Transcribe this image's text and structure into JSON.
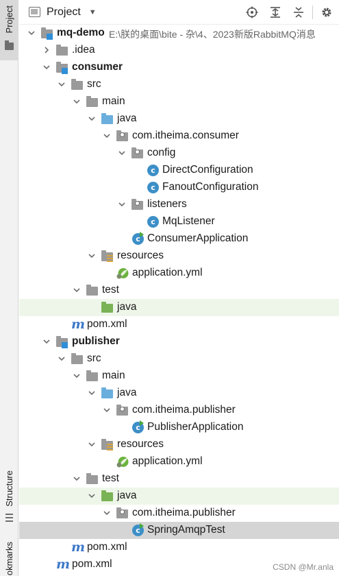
{
  "sidebar": {
    "project_tab": "Project",
    "structure_tab": "Structure",
    "bookmarks_tab": "okmarks"
  },
  "header": {
    "title": "Project",
    "tools": [
      "locate-icon",
      "expand-all-icon",
      "collapse-all-icon",
      "gear-icon"
    ]
  },
  "tree": [
    {
      "label": "mq-demo",
      "path": "E:\\朕的桌面\\bite - 杂\\4、2023新版RabbitMQ消息",
      "icon": "module-folder",
      "bold": true,
      "depth": 0,
      "expanded": true
    },
    {
      "label": ".idea",
      "icon": "folder-grey",
      "depth": 1,
      "expanded": false
    },
    {
      "label": "consumer",
      "icon": "module-folder",
      "bold": true,
      "depth": 1,
      "expanded": true
    },
    {
      "label": "src",
      "icon": "folder-grey",
      "depth": 2,
      "expanded": true
    },
    {
      "label": "main",
      "icon": "folder-grey",
      "depth": 3,
      "expanded": true
    },
    {
      "label": "java",
      "icon": "folder-blue",
      "depth": 4,
      "expanded": true
    },
    {
      "label": "com.itheima.consumer",
      "icon": "package",
      "depth": 5,
      "expanded": true
    },
    {
      "label": "config",
      "icon": "package",
      "depth": 6,
      "expanded": true
    },
    {
      "label": "DirectConfiguration",
      "icon": "class",
      "depth": 7
    },
    {
      "label": "FanoutConfiguration",
      "icon": "class",
      "depth": 7
    },
    {
      "label": "listeners",
      "icon": "package",
      "depth": 6,
      "expanded": true
    },
    {
      "label": "MqListener",
      "icon": "class",
      "depth": 7
    },
    {
      "label": "ConsumerApplication",
      "icon": "class-run",
      "depth": 6
    },
    {
      "label": "resources",
      "icon": "resources",
      "depth": 4,
      "expanded": true
    },
    {
      "label": "application.yml",
      "icon": "spring-yml",
      "depth": 5
    },
    {
      "label": "test",
      "icon": "folder-grey",
      "depth": 3,
      "expanded": true
    },
    {
      "label": "java",
      "icon": "folder-green",
      "depth": 4,
      "highlight": "green"
    },
    {
      "label": "pom.xml",
      "icon": "maven",
      "depth": 2
    },
    {
      "label": "publisher",
      "icon": "module-folder",
      "bold": true,
      "depth": 1,
      "expanded": true
    },
    {
      "label": "src",
      "icon": "folder-grey",
      "depth": 2,
      "expanded": true
    },
    {
      "label": "main",
      "icon": "folder-grey",
      "depth": 3,
      "expanded": true
    },
    {
      "label": "java",
      "icon": "folder-blue",
      "depth": 4,
      "expanded": true
    },
    {
      "label": "com.itheima.publisher",
      "icon": "package",
      "depth": 5,
      "expanded": true
    },
    {
      "label": "PublisherApplication",
      "icon": "class-run",
      "depth": 6
    },
    {
      "label": "resources",
      "icon": "resources",
      "depth": 4,
      "expanded": true
    },
    {
      "label": "application.yml",
      "icon": "spring-yml",
      "depth": 5
    },
    {
      "label": "test",
      "icon": "folder-grey",
      "depth": 3,
      "expanded": true
    },
    {
      "label": "java",
      "icon": "folder-green",
      "depth": 4,
      "expanded": true,
      "highlight": "green"
    },
    {
      "label": "com.itheima.publisher",
      "icon": "package",
      "depth": 5,
      "expanded": true
    },
    {
      "label": "SpringAmqpTest",
      "icon": "class-run",
      "depth": 6,
      "highlight": "selected"
    },
    {
      "label": "pom.xml",
      "icon": "maven",
      "depth": 2
    },
    {
      "label": "pom.xml",
      "icon": "maven",
      "depth": 1
    }
  ],
  "watermark": "CSDN @Mr.anla",
  "colors": {
    "selection": "#d5d5d5",
    "test_highlight": "#eef6e9",
    "source_folder": "#6aaedd",
    "test_folder": "#7ab356",
    "class_icon": "#3d8fc7"
  }
}
